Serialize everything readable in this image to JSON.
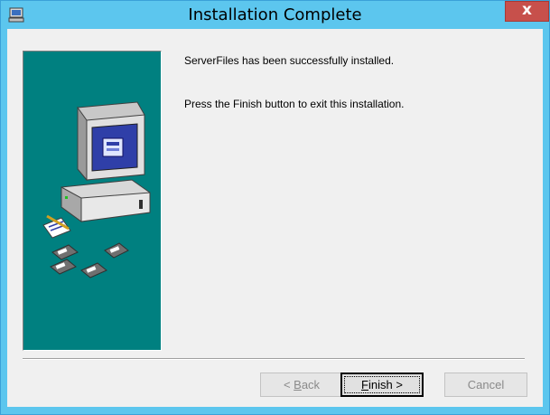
{
  "window": {
    "title": "Installation Complete",
    "close_label": "x"
  },
  "content": {
    "message_installed": "ServerFiles has been successfully installed.",
    "message_finish": "Press the Finish button to exit this installation."
  },
  "buttons": {
    "back": {
      "mnemonic": "B",
      "rest": "ack",
      "prefix": "< ",
      "enabled": false
    },
    "finish": {
      "mnemonic": "F",
      "rest": "inish >",
      "enabled": true,
      "default": true
    },
    "cancel": {
      "label": "Cancel",
      "enabled": false
    }
  },
  "icons": {
    "window_icon": "installer-window-icon",
    "panel_graphic": "computer-with-floppy-disks"
  },
  "colors": {
    "title_bar": "#5cc6ee",
    "close_button": "#c7504b",
    "panel_background": "#008080",
    "dialog_background": "#f0f0f0"
  }
}
